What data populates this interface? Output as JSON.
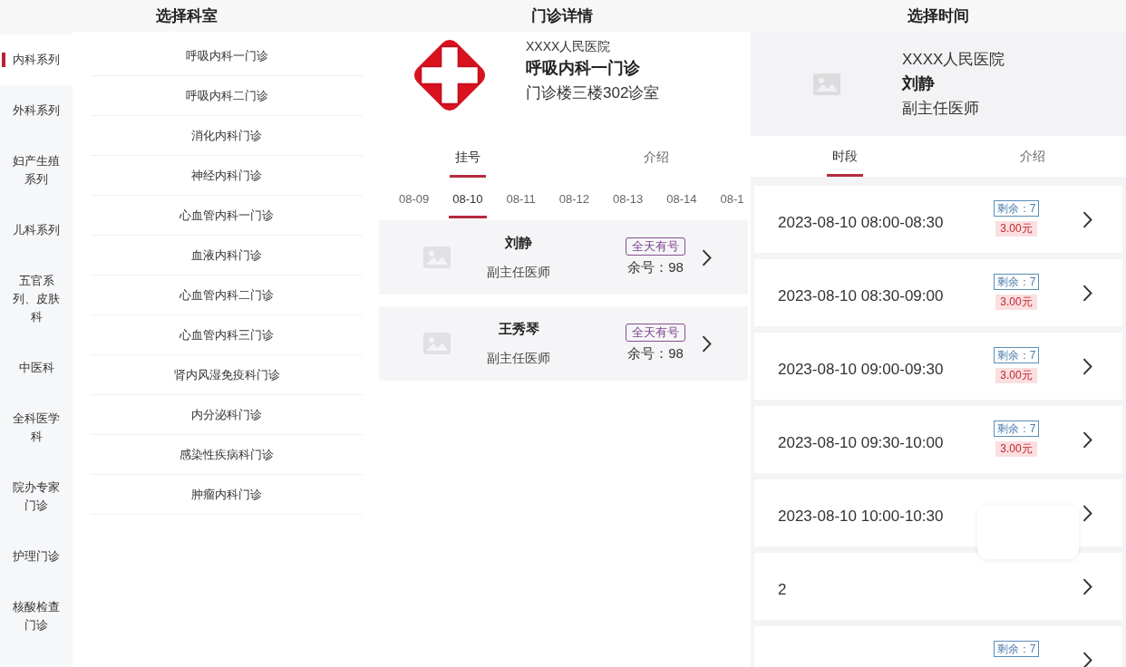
{
  "department_panel": {
    "title": "选择科室",
    "categories": [
      {
        "label": "内科系列",
        "selected": true
      },
      {
        "label": "外科系列",
        "selected": false
      },
      {
        "label": "妇产生殖系列",
        "selected": false
      },
      {
        "label": "儿科系列",
        "selected": false
      },
      {
        "label": "五官系列、皮肤科",
        "selected": false
      },
      {
        "label": "中医科",
        "selected": false
      },
      {
        "label": "全科医学科",
        "selected": false
      },
      {
        "label": "院办专家门诊",
        "selected": false
      },
      {
        "label": "护理门诊",
        "selected": false
      },
      {
        "label": "核酸检查门诊",
        "selected": false
      }
    ],
    "departments": [
      "呼吸内科一门诊",
      "呼吸内科二门诊",
      "消化内科门诊",
      "神经内科门诊",
      "心血管内科一门诊",
      "血液内科门诊",
      "心血管内科二门诊",
      "心血管内科三门诊",
      "肾内风湿免疫科门诊",
      "内分泌科门诊",
      "感染性疾病科门诊",
      "肿瘤内科门诊"
    ]
  },
  "clinic_panel": {
    "title": "门诊详情",
    "hospital": "XXXX人民医院",
    "clinic": "呼吸内科一门诊",
    "location": "门诊楼三楼302诊室",
    "tabs": [
      {
        "label": "挂号",
        "selected": true
      },
      {
        "label": "介绍",
        "selected": false
      }
    ],
    "dates": [
      {
        "label": "08-09",
        "selected": false
      },
      {
        "label": "08-10",
        "selected": true
      },
      {
        "label": "08-11",
        "selected": false
      },
      {
        "label": "08-12",
        "selected": false
      },
      {
        "label": "08-13",
        "selected": false
      },
      {
        "label": "08-14",
        "selected": false
      },
      {
        "label": "08-1",
        "selected": false
      }
    ],
    "doctors": [
      {
        "name": "刘静",
        "title": "副主任医师",
        "availability": "全天有号",
        "remaining": "余号：98"
      },
      {
        "name": "王秀琴",
        "title": "副主任医师",
        "availability": "全天有号",
        "remaining": "余号：98"
      }
    ]
  },
  "time_panel": {
    "title": "选择时间",
    "hospital": "XXXX人民医院",
    "doctor": "刘静",
    "doctor_title": "副主任医师",
    "tabs": [
      {
        "label": "时段",
        "selected": true
      },
      {
        "label": "介绍",
        "selected": false
      }
    ],
    "slots": [
      {
        "time": "2023-08-10 08:00-08:30",
        "remaining": "剩余：7",
        "price": "3.00元"
      },
      {
        "time": "2023-08-10 08:30-09:00",
        "remaining": "剩余：7",
        "price": "3.00元"
      },
      {
        "time": "2023-08-10 09:00-09:30",
        "remaining": "剩余：7",
        "price": "3.00元"
      },
      {
        "time": "2023-08-10 09:30-10:00",
        "remaining": "剩余：7",
        "price": "3.00元"
      },
      {
        "time": "2023-08-10 10:00-10:30"
      },
      {
        "time": "2"
      },
      {
        "remaining": "剩余：7"
      }
    ],
    "popup_visible": true
  }
}
